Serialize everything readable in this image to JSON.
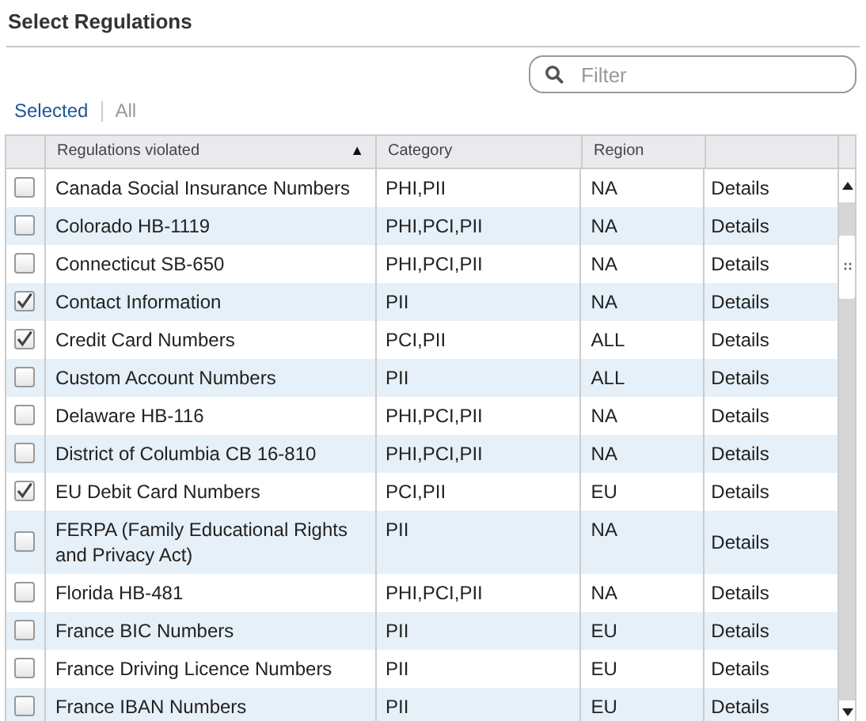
{
  "title": "Select Regulations",
  "filter": {
    "placeholder": "Filter"
  },
  "tabs": [
    {
      "label": "Selected",
      "selected": true
    },
    {
      "label": "All",
      "selected": false
    }
  ],
  "table": {
    "columns": [
      {
        "label": "Regulations violated",
        "sorted": true
      },
      {
        "label": "Category",
        "sorted": false
      },
      {
        "label": "Region",
        "sorted": false
      }
    ],
    "sort_indicator": "▲",
    "rows": [
      {
        "name": "Canada Social Insurance Numbers",
        "category": "PHI,PII",
        "region": "NA",
        "action": "Details",
        "checked": false
      },
      {
        "name": "Colorado HB-1119",
        "category": "PHI,PCI,PII",
        "region": "NA",
        "action": "Details",
        "checked": false
      },
      {
        "name": "Connecticut SB-650",
        "category": "PHI,PCI,PII",
        "region": "NA",
        "action": "Details",
        "checked": false
      },
      {
        "name": "Contact Information",
        "category": "PII",
        "region": "NA",
        "action": "Details",
        "checked": true
      },
      {
        "name": "Credit Card Numbers",
        "category": "PCI,PII",
        "region": "ALL",
        "action": "Details",
        "checked": true
      },
      {
        "name": "Custom Account Numbers",
        "category": "PII",
        "region": "ALL",
        "action": "Details",
        "checked": false
      },
      {
        "name": "Delaware HB-116",
        "category": "PHI,PCI,PII",
        "region": "NA",
        "action": "Details",
        "checked": false
      },
      {
        "name": "District of Columbia CB 16-810",
        "category": "PHI,PCI,PII",
        "region": "NA",
        "action": "Details",
        "checked": false
      },
      {
        "name": "EU Debit Card Numbers",
        "category": "PCI,PII",
        "region": "EU",
        "action": "Details",
        "checked": true
      },
      {
        "name": "FERPA (Family Educational Rights and Privacy Act)",
        "category": "PII",
        "region": "NA",
        "action": "Details",
        "checked": false
      },
      {
        "name": "Florida HB-481",
        "category": "PHI,PCI,PII",
        "region": "NA",
        "action": "Details",
        "checked": false
      },
      {
        "name": "France BIC Numbers",
        "category": "PII",
        "region": "EU",
        "action": "Details",
        "checked": false
      },
      {
        "name": "France Driving Licence Numbers",
        "category": "PII",
        "region": "EU",
        "action": "Details",
        "checked": false
      },
      {
        "name": "France IBAN Numbers",
        "category": "PII",
        "region": "EU",
        "action": "Details",
        "checked": false
      }
    ]
  }
}
